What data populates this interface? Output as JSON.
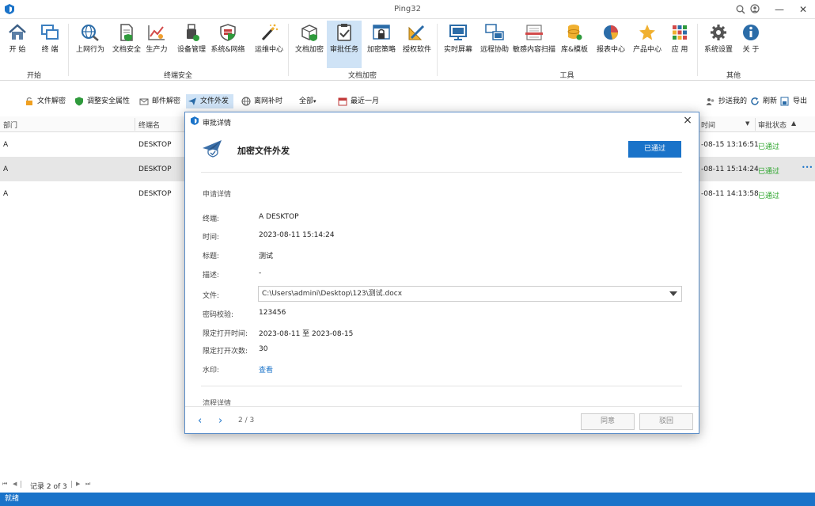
{
  "window": {
    "title": "Ping32"
  },
  "ribbon": {
    "groups": [
      {
        "label": "开始",
        "items": [
          "开 始",
          "终 端"
        ]
      },
      {
        "label": "终端安全",
        "items": [
          "上网行为",
          "文档安全",
          "生产力",
          "设备管理",
          "系统&网络",
          "运维中心"
        ]
      },
      {
        "label": "文档加密",
        "items": [
          "文档加密",
          "审批任务",
          "加密策略",
          "授权软件"
        ]
      },
      {
        "label": "工具",
        "items": [
          "实时屏幕",
          "远程协助",
          "敏感内容扫描",
          "库&模板",
          "报表中心",
          "产品中心",
          "应 用"
        ]
      },
      {
        "label": "其他",
        "items": [
          "系统设置",
          "关 于"
        ]
      }
    ],
    "active_item": "审批任务"
  },
  "toolbar": {
    "items": [
      "文件解密",
      "调整安全属性",
      "邮件解密",
      "文件外发",
      "离网补时"
    ],
    "active": "文件外发",
    "filter_all": "全部",
    "date_range": "最近一月",
    "right_items": [
      "抄送我的",
      "刷新",
      "导出"
    ]
  },
  "table": {
    "headers": {
      "dept": "部门",
      "terminal": "终端名",
      "time": "时间",
      "status": "审批状态"
    },
    "rows": [
      {
        "dept": "A",
        "terminal": "DESKTOP",
        "time": "-08-15 13:16:51",
        "status": "已通过"
      },
      {
        "dept": "A",
        "terminal": "DESKTOP",
        "time": "-08-11 15:14:24",
        "status": "已通过",
        "more": "•••"
      },
      {
        "dept": "A",
        "terminal": "DESKTOP",
        "time": "-08-11 14:13:58",
        "status": "已通过"
      }
    ]
  },
  "pager": {
    "text": "记录 2 of 3"
  },
  "status_bar": {
    "text": "就绪"
  },
  "modal": {
    "title": "审批详情",
    "close": "×",
    "app_title": "加密文件外发",
    "badge": "已通过",
    "section_apply": "申请详情",
    "fields": {
      "terminal_key": "终端:",
      "terminal_val": "A DESKTOP",
      "time_key": "时间:",
      "time_val": "2023-08-11 15:14:24",
      "subject_key": "标题:",
      "subject_val": "测试",
      "desc_key": "描述:",
      "desc_val": "-",
      "file_key": "文件:",
      "file_val": "C:\\Users\\admini\\Desktop\\123\\测试.docx",
      "password_key": "密码校验:",
      "password_val": "123456",
      "open_time_key": "限定打开时间:",
      "open_time_val": "2023-08-11 至 2023-08-15",
      "open_count_key": "限定打开次数:",
      "open_count_val": "30",
      "watermark_key": "水印:",
      "watermark_val": "查看"
    },
    "section_flow": "流程详情",
    "page": "2 / 3",
    "approve": "同意",
    "reject": "驳回",
    "colors": {
      "accent": "#1a73c9",
      "success": "#27a327"
    }
  }
}
